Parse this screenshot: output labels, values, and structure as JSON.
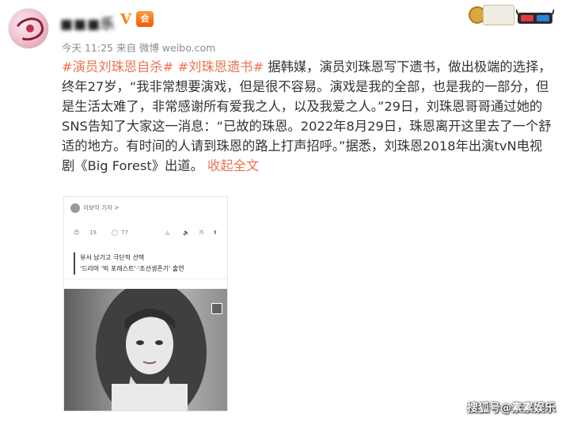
{
  "header": {
    "username": "■■■乐",
    "verified_mark": "V",
    "vip_label": "会",
    "meta": "今天 11:25 来自 微博 weibo.com"
  },
  "post": {
    "tag1": "#演员刘珠恩自杀#",
    "tag2": "#刘珠恩遗书#",
    "body": " 据韩媒，演员刘珠恩写下遗书，做出极端的选择，终年27岁，“我非常想要演戏，但是很不容易。演戏是我的全部，也是我的一部分，但是生活太难了，非常感谢所有爱我之人，以及我爱之人。”29日，刘珠恩哥哥通过她的SNS告知了大家这一消息：“已故的珠恩。2022年8月29日，珠恩离开这里去了一个舒适的地方。有时间的人请到珠恩的路上打声招呼。”据悉，刘珠恩2018年出演tvN电视剧《Big Forest》出道。",
    "collapse_link": "收起全文"
  },
  "embed": {
    "author": "이보익 기자 >",
    "stats": [
      "19",
      "77"
    ],
    "quote_line1": "유서 남기고 극단적 선택",
    "quote_line2": "'드라마 '빅 포레스트'·'조선생존기' 출연"
  },
  "watermark": "搜狐号@素素娱乐"
}
